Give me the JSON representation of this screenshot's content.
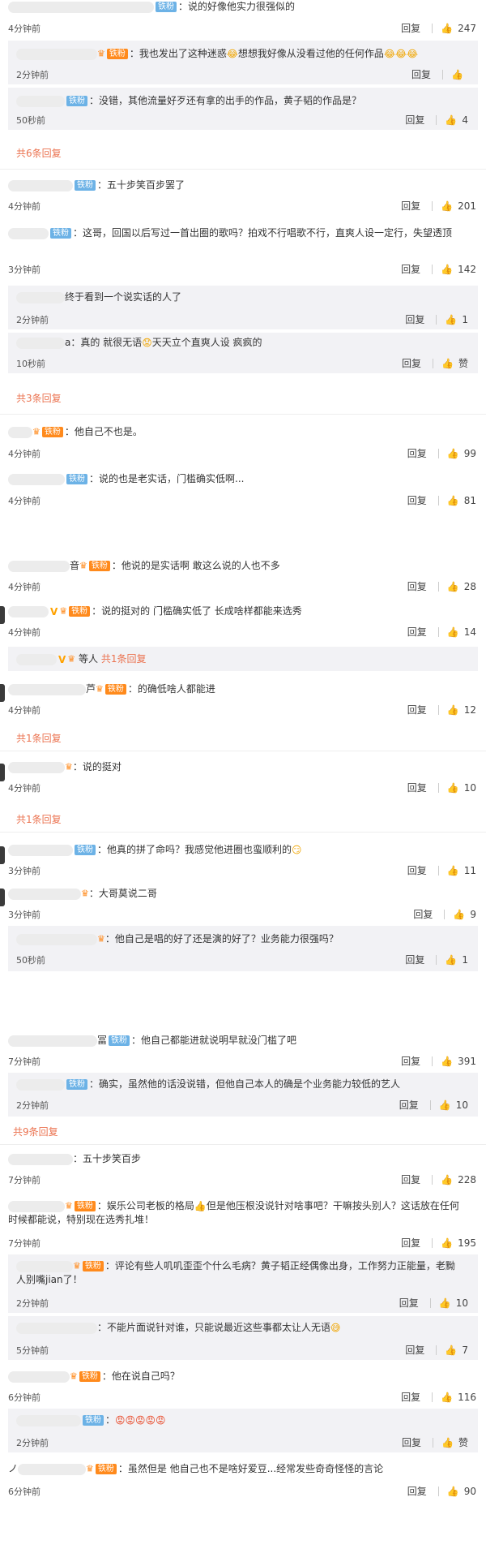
{
  "badges": {
    "fan": "铁粉"
  },
  "labels": {
    "reply": "回复",
    "like": "赞"
  },
  "icons": {
    "thumb": "thumb-up-icon",
    "crown": "crown-icon",
    "verified": "v-icon"
  },
  "colors": {
    "badge_blue": "#6cb2e6",
    "badge_orange": "#ff8a1c",
    "more_link": "#eb7350",
    "reply_bg": "#f2f2f5"
  },
  "section1": {
    "c1": {
      "text": "：说的好像他实力很强似的",
      "time": "4分钟前",
      "likes": "247"
    },
    "r1": {
      "text": "：我也发出了这种迷惑",
      "text2": "想想我好像从没看过他的任何作品",
      "time": "2分钟前",
      "likes": ""
    },
    "r2": {
      "text": "：没错，其他流量好歹还有拿的出手的作品，黄子韬的作品是？",
      "time": "50秒前",
      "likes": "4"
    },
    "more1": "共6条回复",
    "c2": {
      "text": "：五十步笑百步罢了",
      "time": "4分钟前",
      "likes": "201"
    },
    "c3": {
      "text": "：这哥，回国以后写过一首出圈的歌吗？拍戏不行唱歌不行，直爽人设一定行，失望透顶",
      "time": "3分钟前",
      "likes": "142"
    },
    "r3": {
      "text": "终于看到一个说实话的人了",
      "time": "2分钟前",
      "likes": "1"
    },
    "r4": {
      "prefix": "a",
      "text": "：真的 就很无语",
      "text2": "天天立个直爽人设 疯疯的",
      "time": "10秒前",
      "likes": "赞"
    },
    "more2": "共3条回复",
    "c4": {
      "text": "：他自己不也是。",
      "time": "4分钟前",
      "likes": "99"
    },
    "c5": {
      "text": "：说的也是老实话，门槛确实低啊...",
      "time": "4分钟前",
      "likes": "81"
    }
  },
  "section2": {
    "c1": {
      "prefix": "音",
      "text": "：他说的是实话啊 敢这么说的人也不多",
      "time": "4分钟前",
      "likes": "28"
    },
    "c2": {
      "text": "：说的挺对的 门槛确实低了 长成啥样都能来选秀",
      "time": "4分钟前",
      "likes": "14"
    },
    "r1": {
      "text": "等人",
      "more": "共1条回复"
    },
    "c3": {
      "prefix": "芦",
      "text": "：的确低啥人都能进",
      "time": "4分钟前",
      "likes": "12"
    },
    "more1": "共1条回复",
    "c4": {
      "text": "：说的挺对",
      "time": "4分钟前",
      "likes": "10"
    },
    "more2": "共1条回复",
    "c5": {
      "text": "：他真的拼了命吗？我感觉他进圈也蛮顺利的",
      "time": "3分钟前",
      "likes": "11"
    },
    "c6": {
      "text": "：大哥莫说二哥",
      "time": "3分钟前",
      "likes": "9"
    },
    "r2": {
      "text": "：他自己是唱的好了还是演的好了？业务能力很强吗？",
      "time": "50秒前",
      "likes": "1"
    }
  },
  "section3": {
    "c1": {
      "prefix": "冨",
      "text": "：他自己都能进就说明早就没门槛了吧",
      "time": "7分钟前",
      "likes": "391"
    },
    "r1": {
      "text": "：确实，虽然他的话没说错，但他自己本人的确是个业务能力较低的艺人",
      "time": "2分钟前",
      "likes": "10"
    },
    "more1": "共9条回复",
    "c2": {
      "text": "：五十步笑百步",
      "time": "7分钟前",
      "likes": "228"
    },
    "c3": {
      "text": "：娱乐公司老板的格局",
      "text2": "但是他压根没说针对啥事吧？干嘛按头别人？这话放在任何时候都能说，特别现在选秀扎堆！",
      "time": "7分钟前",
      "likes": "195"
    },
    "r2": {
      "text": "：评论有些人叽叽歪歪个什么毛病？黄子韬正经偶像出身，工作努力正能量，老黝人别嘴jian了！",
      "time": "2分钟前",
      "likes": "10"
    },
    "r3": {
      "text": "：不能片面说针对谁，只能说最近这些事都太让人无语",
      "time": "5分钟前",
      "likes": "7"
    },
    "c4": {
      "text": "：他在说自己吗？",
      "time": "6分钟前",
      "likes": "116"
    },
    "r4": {
      "text": "：",
      "time": "2分钟前",
      "likes": "赞"
    },
    "c5": {
      "prefix": "ノ",
      "text": "：虽然但是 他自己也不是啥好爱豆...经常发些奇奇怪怪的言论",
      "time": "6分钟前",
      "likes": "90"
    }
  }
}
